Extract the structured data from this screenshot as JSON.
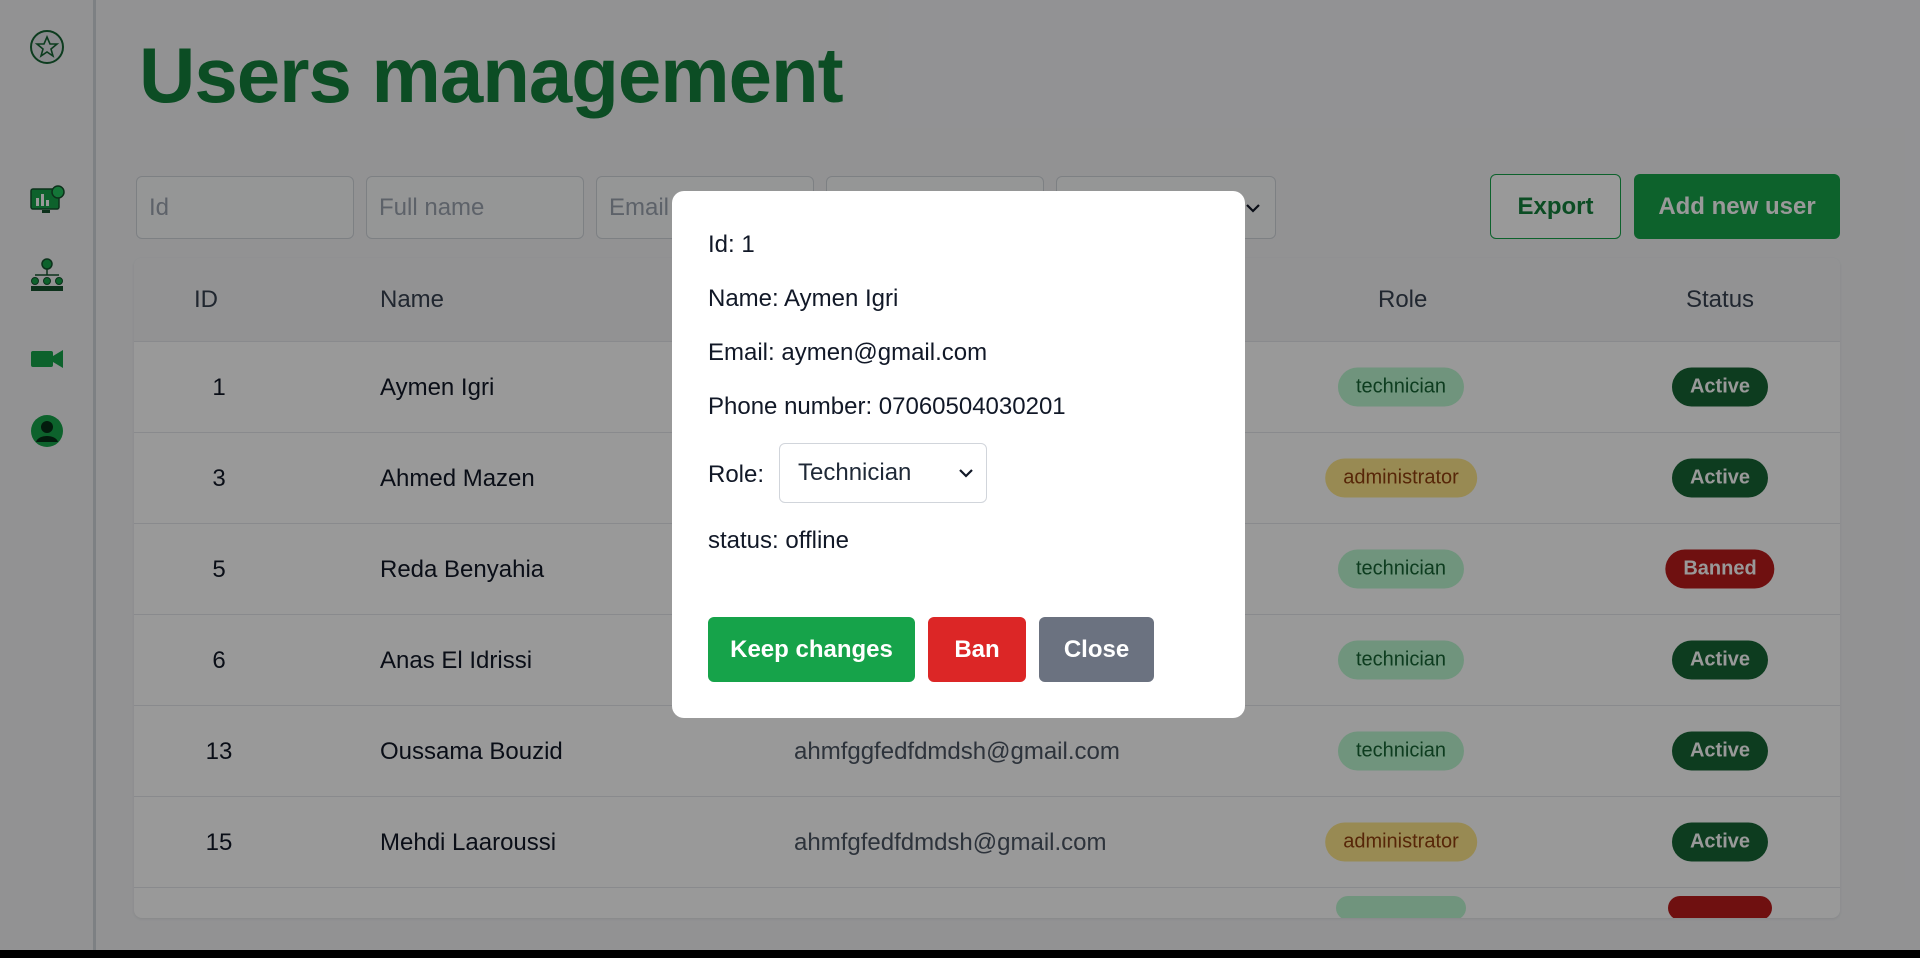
{
  "page": {
    "title": "Users management"
  },
  "filters": {
    "id_placeholder": "Id",
    "fullname_placeholder": "Full name",
    "email_placeholder": "Email"
  },
  "actions": {
    "export_label": "Export",
    "add_label": "Add new user"
  },
  "table": {
    "headers": {
      "id": "ID",
      "name": "Name",
      "role": "Role",
      "status": "Status"
    },
    "rows": [
      {
        "id": "1",
        "name": "Aymen Igri",
        "email": "",
        "role": "technician",
        "status": "Active"
      },
      {
        "id": "3",
        "name": "Ahmed Mazen",
        "email": "",
        "role": "administrator",
        "status": "Active"
      },
      {
        "id": "5",
        "name": "Reda Benyahia",
        "email": "",
        "role": "technician",
        "status": "Banned"
      },
      {
        "id": "6",
        "name": "Anas El Idrissi",
        "email": "",
        "role": "technician",
        "status": "Active"
      },
      {
        "id": "13",
        "name": "Oussama Bouzid",
        "email": "ahmfggfedfdmdsh@gmail.com",
        "role": "technician",
        "status": "Active"
      },
      {
        "id": "15",
        "name": "Mehdi Laaroussi",
        "email": "ahmfgfedfdmdsh@gmail.com",
        "role": "administrator",
        "status": "Active"
      }
    ]
  },
  "modal": {
    "id_line": "Id: 1",
    "name_line": "Name: Aymen Igri",
    "email_line": "Email: aymen@gmail.com",
    "phone_line": "Phone number: 07060504030201",
    "role_label": "Role:",
    "role_value": "Technician",
    "status_line": "status: offline",
    "keep_label": "Keep changes",
    "ban_label": "Ban",
    "close_label": "Close"
  },
  "colors": {
    "brand": "#16a34a",
    "title": "#15803d",
    "danger": "#dc2626",
    "neutral": "#6b7280"
  },
  "icons": {
    "logo": "emblem-icon",
    "dashboard": "dashboard-monitor-icon",
    "team": "team-hierarchy-icon",
    "video": "video-camera-icon",
    "profile": "user-profile-icon"
  }
}
